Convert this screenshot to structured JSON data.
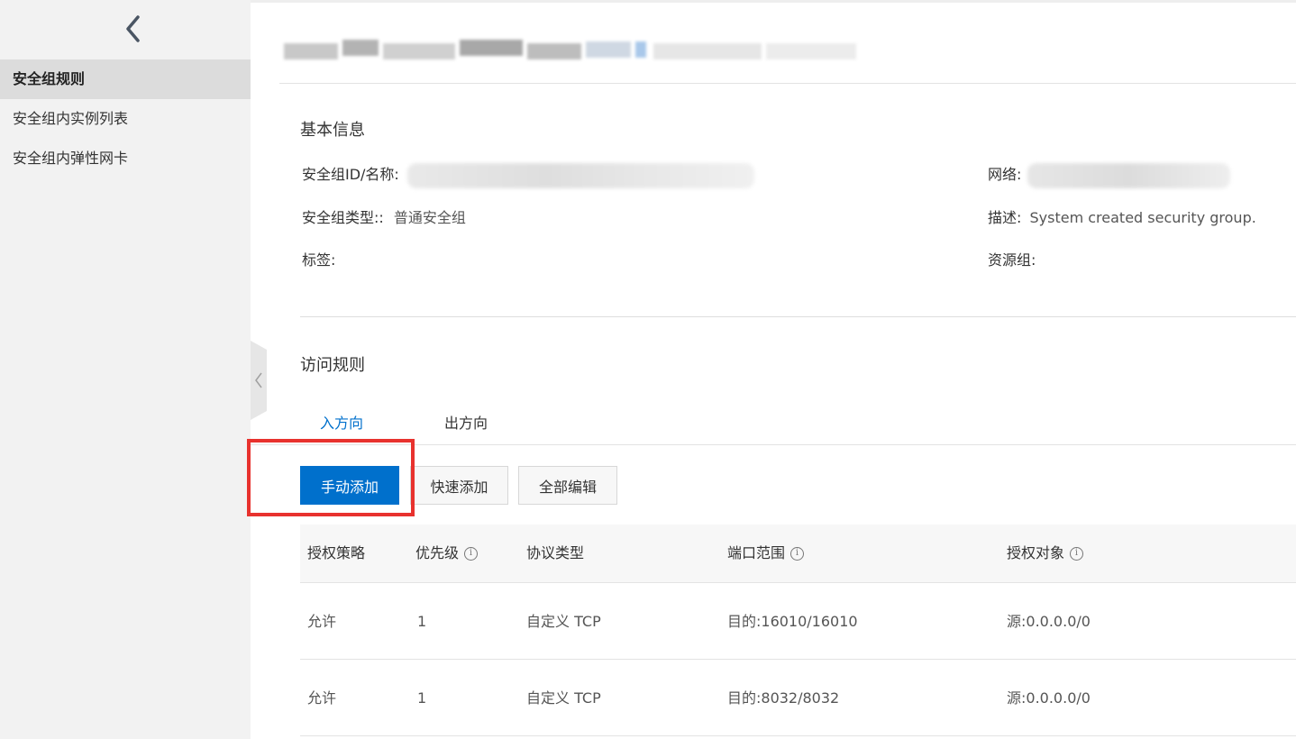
{
  "sidebar": {
    "items": [
      {
        "label": "安全组规则"
      },
      {
        "label": "安全组内实例列表"
      },
      {
        "label": "安全组内弹性网卡"
      }
    ]
  },
  "basic_info": {
    "title": "基本信息",
    "group_id_label": "安全组ID/名称:",
    "network_label": "网络:",
    "type_label": "安全组类型::",
    "type_value": "普通安全组",
    "desc_label": "描述:",
    "desc_value": "System created security group.",
    "tags_label": "标签:",
    "resource_group_label": "资源组:"
  },
  "access_rules": {
    "title": "访问规则",
    "tabs": [
      {
        "label": "入方向"
      },
      {
        "label": "出方向"
      }
    ],
    "buttons": {
      "manual_add": "手动添加",
      "quick_add": "快速添加",
      "edit_all": "全部编辑"
    },
    "table": {
      "columns": [
        "授权策略",
        "优先级",
        "协议类型",
        "端口范围",
        "授权对象"
      ],
      "rows": [
        [
          "允许",
          "1",
          "自定义 TCP",
          "目的:16010/16010",
          "源:0.0.0.0/0"
        ],
        [
          "允许",
          "1",
          "自定义 TCP",
          "目的:8032/8032",
          "源:0.0.0.0/0"
        ]
      ]
    }
  },
  "colors": {
    "accent": "#0070cc",
    "highlight": "#e8322e",
    "brand": "#ff6a00"
  }
}
